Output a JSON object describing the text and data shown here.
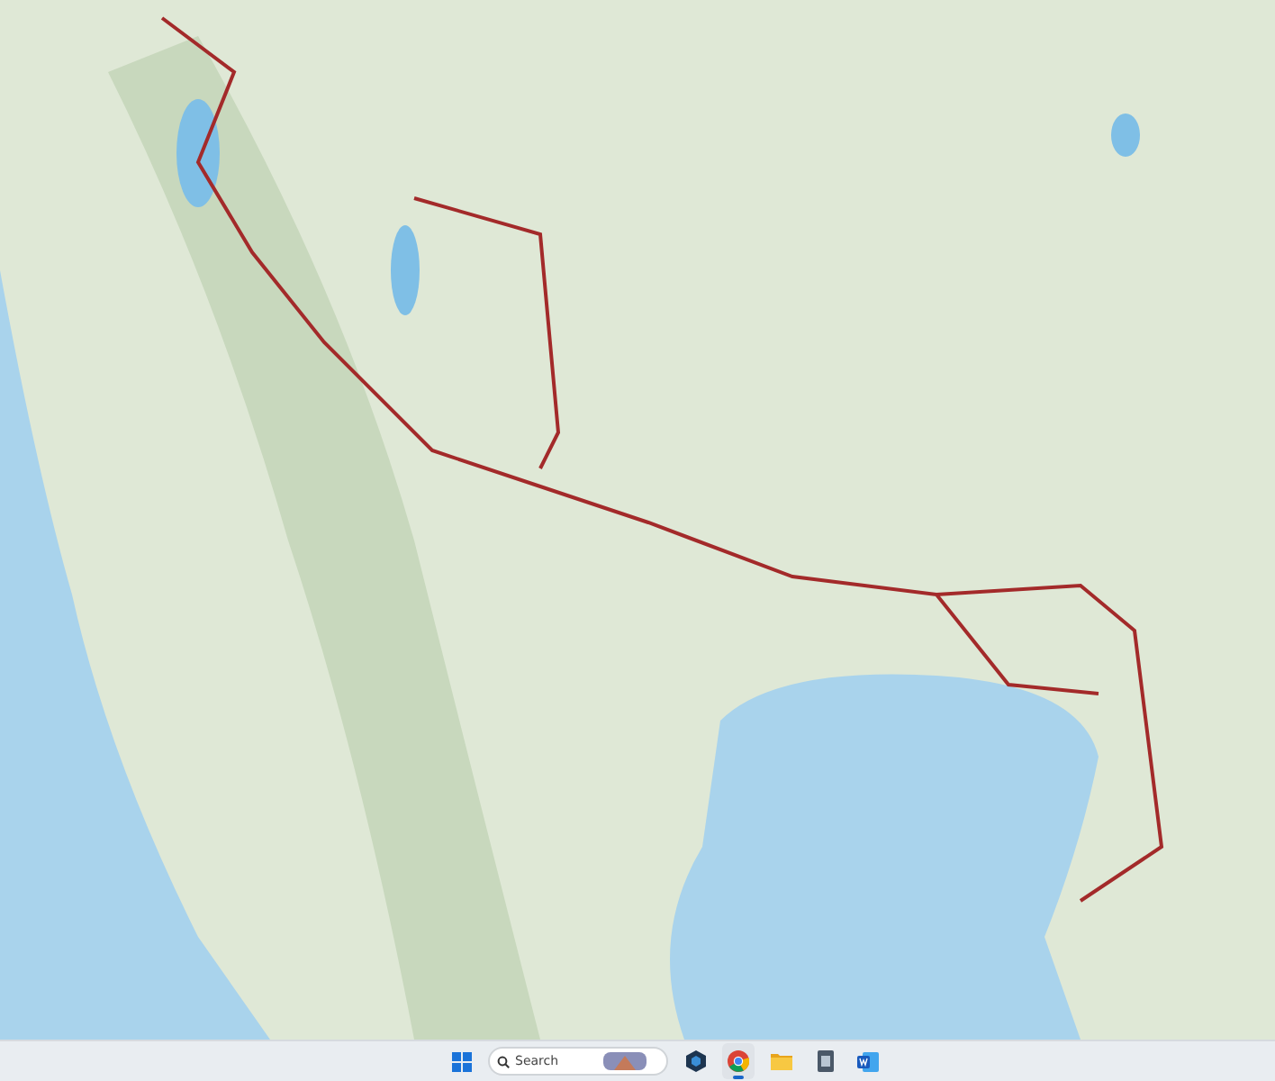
{
  "taskbar": {
    "search": {
      "placeholder": "Search"
    },
    "apps": [
      {
        "kind": "hexagon",
        "selected": false
      },
      {
        "kind": "browser",
        "selected": true
      },
      {
        "kind": "folder",
        "selected": false
      },
      {
        "kind": "document",
        "selected": false
      },
      {
        "kind": "word",
        "selected": false
      }
    ]
  }
}
